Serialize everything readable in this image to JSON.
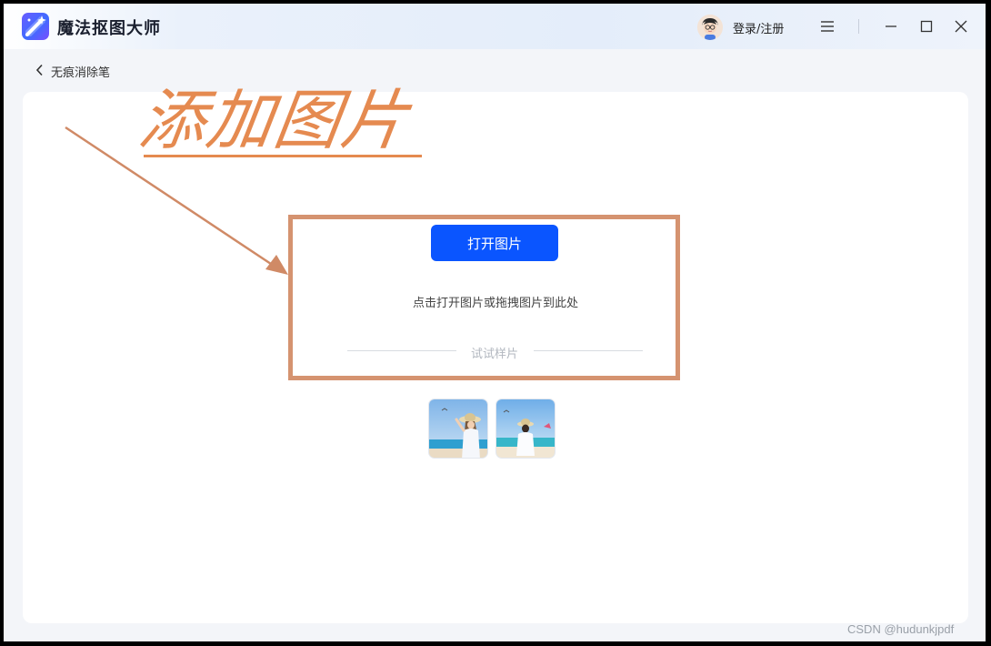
{
  "app": {
    "title": "魔法抠图大师",
    "logo_icon": "magic-wand-icon",
    "accent_color": "#0a55ff"
  },
  "titlebar": {
    "login_label": "登录/注册",
    "menu_icon": "hamburger-menu-icon",
    "minimize_icon": "minimize-icon",
    "maximize_icon": "maximize-icon",
    "close_icon": "close-icon"
  },
  "nav": {
    "back_label": "无痕消除笔",
    "back_icon": "chevron-left-icon"
  },
  "annotation": {
    "text": "添加图片",
    "color": "#e58a50",
    "frame_color": "#d59370"
  },
  "upload": {
    "open_button_label": "打开图片",
    "hint": "点击打开图片或拖拽图片到此处",
    "sample_divider_label": "试试样片"
  },
  "samples": [
    {
      "name": "sample-image-1"
    },
    {
      "name": "sample-image-2"
    }
  ],
  "watermark": "CSDN @hudunkjpdf"
}
